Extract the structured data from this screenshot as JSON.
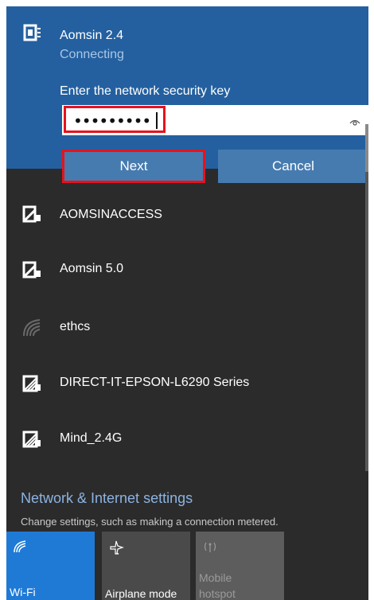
{
  "active_network": {
    "ssid": "Aomsin 2.4",
    "status": "Connecting",
    "prompt": "Enter the network security key",
    "password_mask": "•••••••••",
    "next_label": "Next",
    "cancel_label": "Cancel",
    "icon": "secured-wifi-icon"
  },
  "networks": [
    {
      "ssid": "AOMSINACCESS",
      "icon": "secured-wifi-icon"
    },
    {
      "ssid": "Aomsin 5.0",
      "icon": "secured-wifi-icon"
    },
    {
      "ssid": "ethcs",
      "icon": "weak-wifi-icon"
    },
    {
      "ssid": "DIRECT-IT-EPSON-L6290 Series",
      "icon": "secured-wifi-icon"
    },
    {
      "ssid": "Mind_2.4G",
      "icon": "secured-wifi-icon"
    }
  ],
  "settings": {
    "link": "Network & Internet settings",
    "description": "Change settings, such as making a connection metered."
  },
  "quick_actions": [
    {
      "label": "Wi-Fi",
      "icon": "wifi-icon"
    },
    {
      "label": "Airplane mode",
      "icon": "airplane-icon"
    },
    {
      "label_line1": "Mobile",
      "label_line2": "hotspot",
      "icon": "hotspot-icon"
    }
  ],
  "colors": {
    "panel_bg": "#2b2b2b",
    "active_bg": "#24609f",
    "button_bg": "#467bb0",
    "highlight": "#e8121c",
    "accent": "#1f7ad6",
    "link": "#8cb3e3"
  }
}
